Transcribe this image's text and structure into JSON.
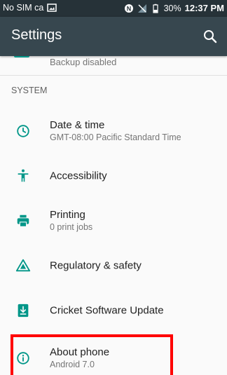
{
  "status_bar": {
    "carrier": "No SIM ca",
    "battery": "30%",
    "time": "12:37 PM"
  },
  "app_bar": {
    "title": "Settings"
  },
  "partial_item": {
    "subtitle": "Backup disabled"
  },
  "section_header": "SYSTEM",
  "items": [
    {
      "title": "Date & time",
      "subtitle": "GMT-08:00 Pacific Standard Time",
      "icon": "clock-icon"
    },
    {
      "title": "Accessibility",
      "subtitle": "",
      "icon": "accessibility-icon"
    },
    {
      "title": "Printing",
      "subtitle": "0 print jobs",
      "icon": "printer-icon"
    },
    {
      "title": "Regulatory & safety",
      "subtitle": "",
      "icon": "regulatory-icon"
    },
    {
      "title": "Cricket Software Update",
      "subtitle": "",
      "icon": "download-icon"
    },
    {
      "title": "About phone",
      "subtitle": "Android 7.0",
      "icon": "info-icon"
    }
  ],
  "colors": {
    "status_bar": "#263238",
    "app_bar": "#37474f",
    "accent": "#009688",
    "highlight": "#ff0000"
  }
}
